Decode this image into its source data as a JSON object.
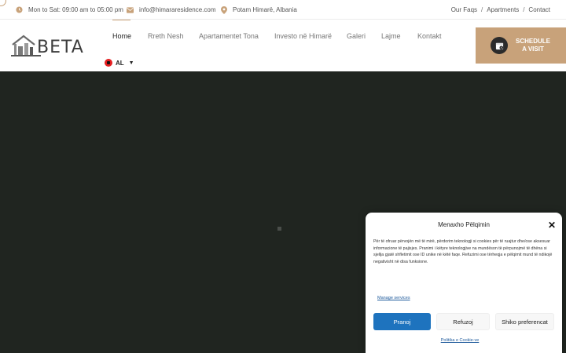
{
  "topbar": {
    "hours": "Mon to Sat: 09:00 am to 05:00 pm",
    "email": "info@himararesidence.com",
    "location": "Potam Himarë, Albania",
    "links": [
      "Our Faqs",
      "Apartments",
      "Contact"
    ],
    "separator": "/"
  },
  "header": {
    "logo_text": "BETA",
    "nav": [
      "Home",
      "Rreth Nesh",
      "Apartamentet Tona",
      "Investo në Himarë",
      "Galeri",
      "Lajme",
      "Kontakt"
    ],
    "active_nav": "Home",
    "language": "AL",
    "cta_label": "SCHEDULE A VISIT"
  },
  "cookie_modal": {
    "title": "Menaxho Pëlqimin",
    "body": "Për të ofruar përvojën më të mirë, përdorim teknologji si cookies për të ruajtur dhe/ose aksesuar informacione të pajisjes. Pranimi i këtyre teknologjive na mundëson të përpunojmë të dhëna si sjellja gjatë shfletimit ose ID unike në këtë faqe. Refuzimi ose tërheqja e pëlqimit mund të ndikojë negativisht në disa funksione.",
    "manage_link": "Manage services",
    "accept": "Pranoj",
    "deny": "Refuzoj",
    "preferences": "Shiko preferencat",
    "policy_link": "Politika e Cookie-ve"
  },
  "colors": {
    "accent": "#c8a27a",
    "hero_bg": "#202520",
    "primary_button": "#1e73be"
  },
  "icons": {
    "hours": "clock-icon",
    "email": "mail-icon",
    "location": "map-pin-icon",
    "cta": "calendar-icon",
    "close": "close-icon"
  }
}
